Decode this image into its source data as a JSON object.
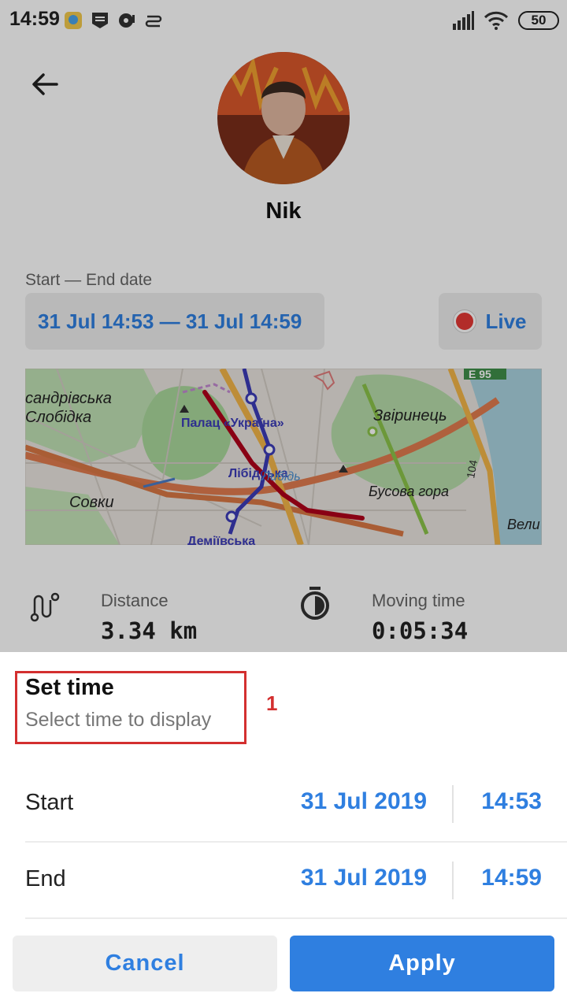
{
  "statusbar": {
    "time": "14:59",
    "battery": "50"
  },
  "profile": {
    "name": "Nik"
  },
  "dates": {
    "label": "Start — End date",
    "range": "31 Jul 14:53 — 31 Jul 14:59",
    "live_label": "Live"
  },
  "map": {
    "labels": [
      "сандрівська",
      "Слобідка",
      "Палац «Україна»",
      "Лібідська",
      "Либідь",
      "Совки",
      "Деміївська",
      "Звіринець",
      "Бусова гора",
      "Вели",
      "E 95",
      "104"
    ]
  },
  "stats": {
    "distance_label": "Distance",
    "distance_value": "3.34 km",
    "moving_label": "Moving time",
    "moving_value": "0:05:34"
  },
  "sheet": {
    "title": "Set time",
    "subtitle": "Select time to display",
    "annotation": "1",
    "start": {
      "label": "Start",
      "date": "31 Jul 2019",
      "time": "14:53"
    },
    "end": {
      "label": "End",
      "date": "31 Jul 2019",
      "time": "14:59"
    },
    "cancel_label": "Cancel",
    "apply_label": "Apply"
  },
  "colors": {
    "accent": "#2f7fe0",
    "live": "#e53935",
    "annotation": "#d32f2f",
    "track": "#b0001a"
  }
}
